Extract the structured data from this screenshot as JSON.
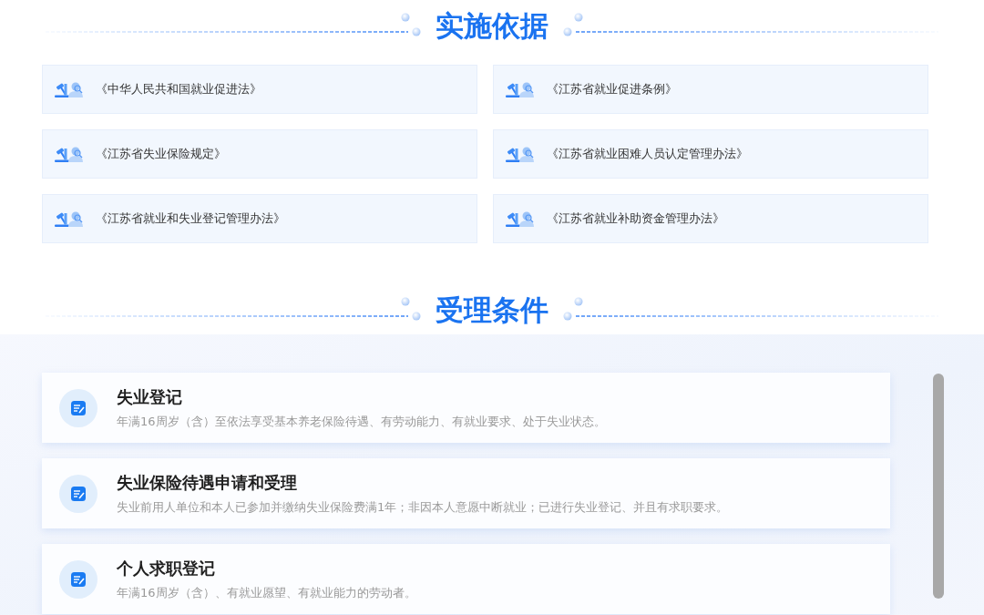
{
  "basis": {
    "title": "实施依据",
    "documents": [
      "《中华人民共和国就业促进法》",
      "《江苏省就业促进条例》",
      "《江苏省失业保险规定》",
      "《江苏省就业困难人员认定管理办法》",
      "《江苏省就业和失业登记管理办法》",
      "《江苏省就业补助资金管理办法》"
    ]
  },
  "conditions": {
    "title": "受理条件",
    "items": [
      {
        "title": "失业登记",
        "description": "年满16周岁（含）至依法享受基本养老保险待遇、有劳动能力、有就业要求、处于失业状态。"
      },
      {
        "title": "失业保险待遇申请和受理",
        "description": "失业前用人单位和本人已参加并缴纳失业保险费满1年；非因本人意愿中断就业；已进行失业登记、并且有求职要求。"
      },
      {
        "title": "个人求职登记",
        "description": "年满16周岁（含）、有就业愿望、有就业能力的劳动者。"
      }
    ]
  }
}
